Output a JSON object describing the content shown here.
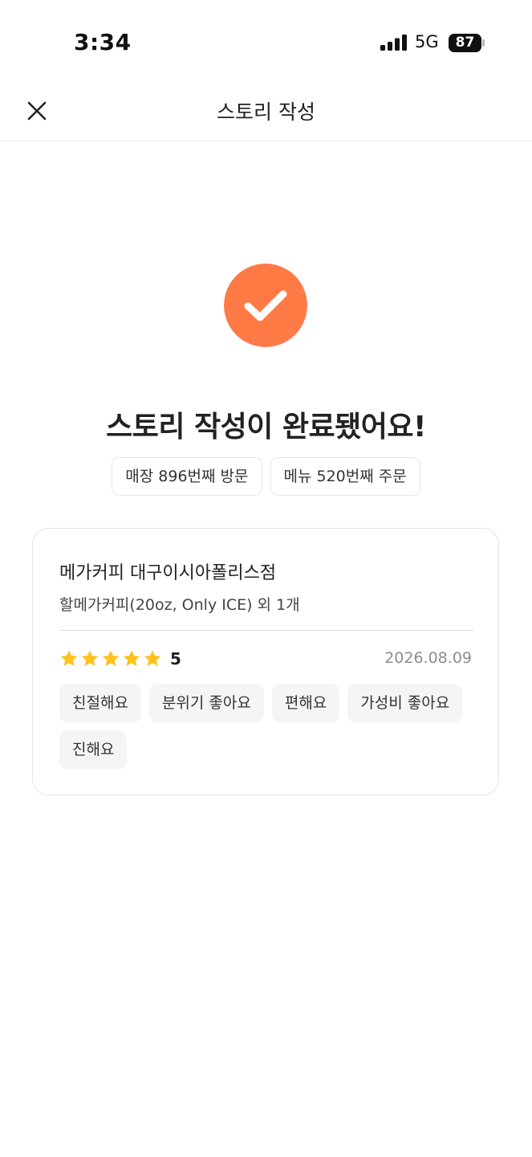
{
  "status_bar": {
    "time": "3:34",
    "network": "5G",
    "battery": "87"
  },
  "header": {
    "title": "스토리 작성",
    "close_icon": "close-icon"
  },
  "completion": {
    "icon": "check-circle-icon",
    "accent_color": "#FF7A45",
    "title": "스토리 작성이 완료됐어요!",
    "badges": [
      "매장 896번째 방문",
      "메뉴 520번째 주문"
    ]
  },
  "story": {
    "store_name": "메가커피 대구이시아폴리스점",
    "menu": "할메가커피(20oz, Only ICE) 외 1개",
    "rating": "5",
    "rating_stars": 5,
    "star_color": "#FFC21A",
    "date": "2026.08.09",
    "tags": [
      "친절해요",
      "분위기 좋아요",
      "편해요",
      "가성비 좋아요",
      "진해요"
    ]
  }
}
